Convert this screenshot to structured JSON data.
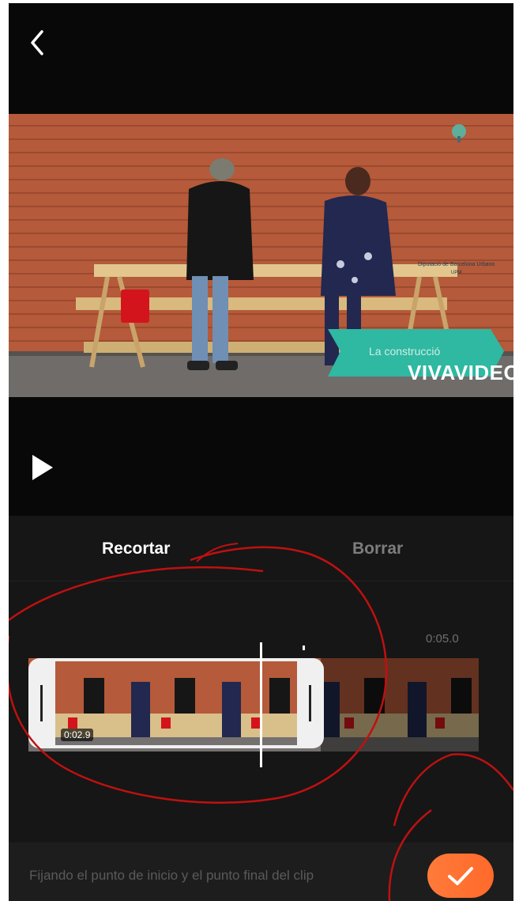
{
  "preview": {
    "watermark": "VIVAVIDEO",
    "banner_text": "La construcció",
    "logo_label": "Diputació de Barcelona Urbano",
    "logo_sub": "UPM"
  },
  "tabs": {
    "trim": "Recortar",
    "delete": "Borrar"
  },
  "timeline": {
    "end_time": "0:05.0",
    "start_time": "0:02.9"
  },
  "footer": {
    "hint": "Fijando el punto de inicio y el punto final del clip"
  },
  "colors": {
    "accent": "#ff6a2a",
    "annotation": "#c01010",
    "brick": "#b55a3a"
  },
  "icons": [
    "chevron-left-icon",
    "play-icon",
    "checkmark-icon"
  ]
}
